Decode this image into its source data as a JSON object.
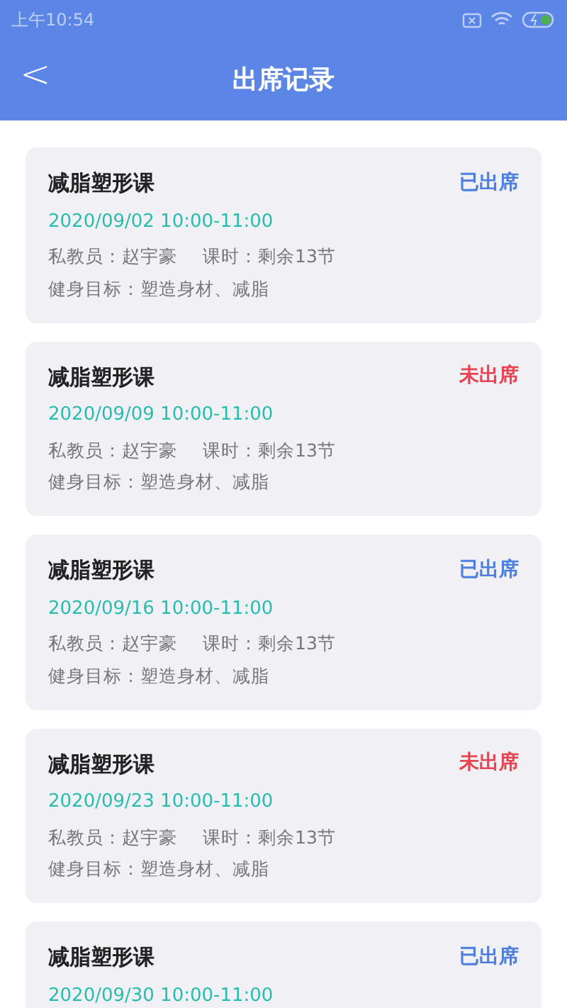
{
  "status_bar": {
    "time": "上午10:54"
  },
  "header": {
    "back": "<",
    "title": "出席记录"
  },
  "records": [
    {
      "course": "减脂塑形课",
      "attended": true,
      "status": "已出席",
      "datetime": "2020/09/02 10:00-11:00",
      "coach": "私教员：赵宇豪",
      "hours": "课时：剩余13节",
      "goal": "健身目标：塑造身材、减脂"
    },
    {
      "course": "减脂塑形课",
      "attended": false,
      "status": "未出席",
      "datetime": "2020/09/09 10:00-11:00",
      "coach": "私教员：赵宇豪",
      "hours": "课时：剩余13节",
      "goal": "健身目标：塑造身材、减脂"
    },
    {
      "course": "减脂塑形课",
      "attended": true,
      "status": "已出席",
      "datetime": "2020/09/16 10:00-11:00",
      "coach": "私教员：赵宇豪",
      "hours": "课时：剩余13节",
      "goal": "健身目标：塑造身材、减脂"
    },
    {
      "course": "减脂塑形课",
      "attended": false,
      "status": "未出席",
      "datetime": "2020/09/23 10:00-11:00",
      "coach": "私教员：赵宇豪",
      "hours": "课时：剩余13节",
      "goal": "健身目标：塑造身材、减脂"
    },
    {
      "course": "减脂塑形课",
      "attended": true,
      "status": "已出席",
      "datetime": "2020/09/30 10:00-11:00"
    }
  ]
}
